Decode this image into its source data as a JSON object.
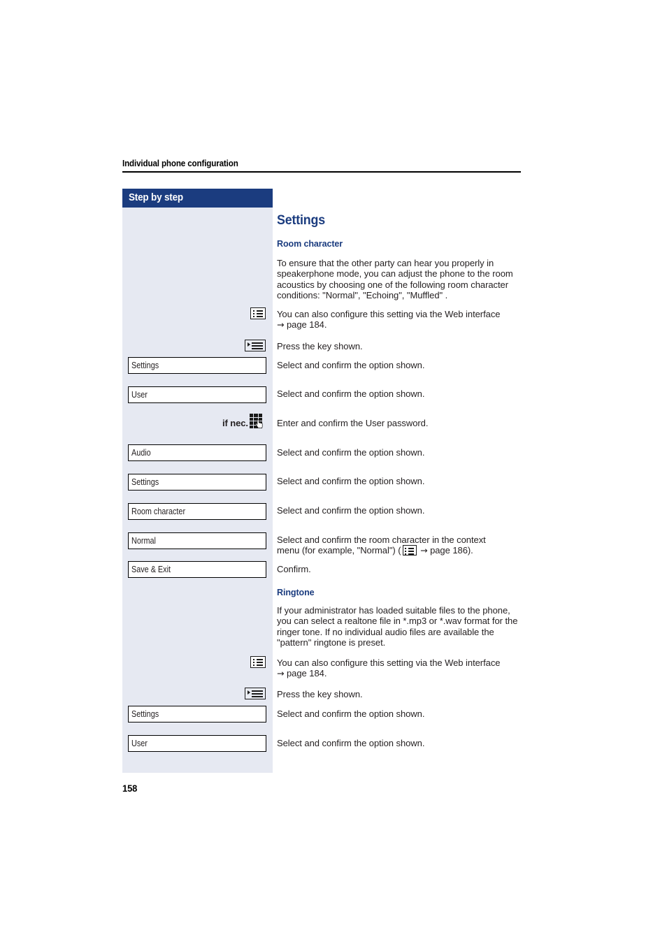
{
  "page": {
    "running_header": "Individual phone configuration",
    "folio": "158",
    "sidebar_banner": "Step by step",
    "accent_color": "#1b3c7f",
    "sidebar_bg": "#e6e9f2",
    "body_text_color": "#231f20"
  },
  "section": {
    "title": "Settings",
    "subsections": [
      {
        "heading": "Room character"
      },
      {
        "heading": "Ringtone"
      }
    ]
  },
  "paragraphs": {
    "room_character_intro": "To ensure that the other party can hear you properly in speakerphone mode, you can adjust the phone to the room acoustics by choosing one of the following room character conditions: \"Normal\", \"Echoing\", \"Muffled\" .",
    "web_interface_note": "You can also configure this setting via the Web interface",
    "web_interface_ref": "page 184.",
    "press_key": "Press the key shown.",
    "select_confirm": "Select and confirm the option shown.",
    "enter_password": "Enter and confirm the User password.",
    "select_room_character_1": "Select and confirm the room character in the context",
    "select_room_character_2a": "menu (for example, \"Normal\") (",
    "select_room_character_2b": "page 186).",
    "confirm": "Confirm.",
    "ringtone_intro": "If your administrator has loaded suitable files to the phone, you can select a realtone file in *.mp3 or *.wav format for the ringer tone. If no individual audio files are available the \"pattern\" ringtone is preset.",
    "web_interface_note_2": "You can also configure this setting via the Web interface",
    "web_interface_ref_2": "page 184.",
    "press_key_2": "Press the key shown."
  },
  "steps": [
    {
      "type": "icon",
      "icon": "web-interface-icon",
      "label": ""
    },
    {
      "type": "icon",
      "icon": "menu-key-icon",
      "label": ""
    },
    {
      "type": "box",
      "label": "Settings"
    },
    {
      "type": "box",
      "label": "User"
    },
    {
      "type": "keypad",
      "prefix": "if nec.",
      "icon": "keypad-icon",
      "label": "if nec."
    },
    {
      "type": "box",
      "label": "Audio"
    },
    {
      "type": "box",
      "label": "Settings"
    },
    {
      "type": "box",
      "label": "Room character"
    },
    {
      "type": "box",
      "label": "Normal"
    },
    {
      "type": "box",
      "label": "Save & Exit"
    },
    {
      "type": "icon",
      "icon": "web-interface-icon",
      "label": ""
    },
    {
      "type": "icon",
      "icon": "menu-key-icon",
      "label": ""
    },
    {
      "type": "box",
      "label": "Settings"
    },
    {
      "type": "box",
      "label": "User"
    }
  ],
  "glyphs": {
    "arrow_right": "→"
  }
}
